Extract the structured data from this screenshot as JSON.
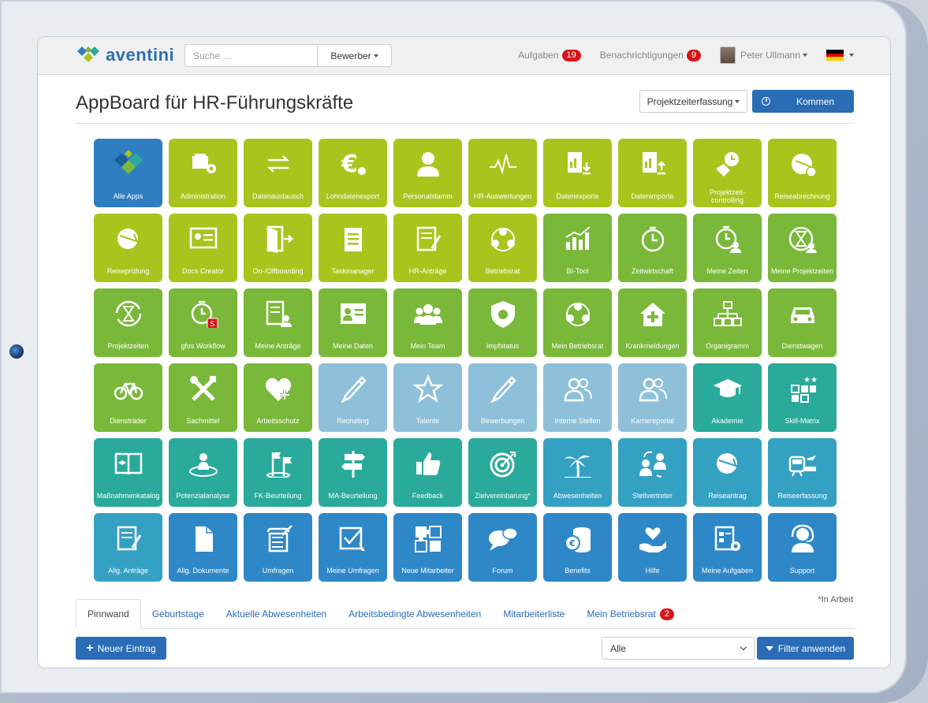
{
  "brand": {
    "name": "aventini"
  },
  "header": {
    "search_placeholder": "Suche ...",
    "search_scope": "Bewerber",
    "tasks_label": "Aufgaben",
    "tasks_count": "19",
    "notifications_label": "Benachrichtigungen",
    "notifications_count": "9",
    "user_name": "Peter Ullmann"
  },
  "page": {
    "title": "AppBoard für HR-Führungskräfte",
    "project_button": "Projektzeiterfassung",
    "kommen_button": "Kommen"
  },
  "tiles": [
    {
      "label": "Alle Apps",
      "color": "blue",
      "icon": "diamond-logo-icon"
    },
    {
      "label": "Administration",
      "color": "lime",
      "icon": "admin-icon"
    },
    {
      "label": "Datenaustausch",
      "color": "lime",
      "icon": "exchange-arrows-icon"
    },
    {
      "label": "Lohndatenexport",
      "color": "lime",
      "icon": "euro-icon"
    },
    {
      "label": "Personalstamm",
      "color": "lime",
      "icon": "person-icon"
    },
    {
      "label": "HR-Auswertungen",
      "color": "lime",
      "icon": "pulse-icon"
    },
    {
      "label": "Datenexporte",
      "color": "lime",
      "icon": "xls-export-icon"
    },
    {
      "label": "Datenimporte",
      "color": "lime",
      "icon": "xls-import-icon"
    },
    {
      "label": "Projektzeit-controlling",
      "color": "lime",
      "icon": "hand-clock-icon"
    },
    {
      "label": "Reiseabrechnung",
      "color": "lime",
      "icon": "globe-plane-euro-icon"
    },
    {
      "label": "Reiseprüfung",
      "color": "lime",
      "icon": "globe-plane-icon"
    },
    {
      "label": "Docs Creator",
      "color": "lime",
      "icon": "certificate-icon"
    },
    {
      "label": "On-/Offboarding",
      "color": "lime",
      "icon": "door-icon"
    },
    {
      "label": "Taskmanager",
      "color": "lime",
      "icon": "clipboard-icon"
    },
    {
      "label": "HR-Anträge",
      "color": "lime",
      "icon": "form-pen-icon"
    },
    {
      "label": "Betriebsrat",
      "color": "lime",
      "icon": "group-circle-icon"
    },
    {
      "label": "BI-Tool",
      "color": "green",
      "icon": "bar-chart-icon"
    },
    {
      "label": "Zeitwirtschaft",
      "color": "green",
      "icon": "stopwatch-icon"
    },
    {
      "label": "Meine Zeiten",
      "color": "green",
      "icon": "stopwatch-person-icon"
    },
    {
      "label": "Meine Projektzeiten",
      "color": "green",
      "icon": "hourglass-person-icon"
    },
    {
      "label": "Projektzeiten",
      "color": "green",
      "icon": "hourglass-icon"
    },
    {
      "label": "gfos Workflow",
      "color": "green",
      "icon": "stopwatch-badge-icon"
    },
    {
      "label": "Meine Anträge",
      "color": "green",
      "icon": "form-person-icon"
    },
    {
      "label": "Meine Daten",
      "color": "green",
      "icon": "id-card-icon"
    },
    {
      "label": "Mein Team",
      "color": "green",
      "icon": "team-icon"
    },
    {
      "label": "Impfstatus",
      "color": "green",
      "icon": "shield-virus-icon"
    },
    {
      "label": "Mein Betriebsrat",
      "color": "green",
      "icon": "group-circle-icon"
    },
    {
      "label": "Krankmeldungen",
      "color": "green",
      "icon": "house-cross-icon"
    },
    {
      "label": "Organigramm",
      "color": "green",
      "icon": "org-chart-icon"
    },
    {
      "label": "Dienstwagen",
      "color": "green",
      "icon": "car-icon"
    },
    {
      "label": "Diensträder",
      "color": "green",
      "icon": "bicycle-icon"
    },
    {
      "label": "Sachmittel",
      "color": "green",
      "icon": "tools-icon"
    },
    {
      "label": "Arbeitsschutz",
      "color": "green",
      "icon": "heart-plus-icon"
    },
    {
      "label": "Recruiting",
      "color": "lightblue",
      "icon": "fountain-pen-icon"
    },
    {
      "label": "Talente",
      "color": "lightblue",
      "icon": "star-icon"
    },
    {
      "label": "Bewerbungen",
      "color": "lightblue",
      "icon": "fountain-pen-icon"
    },
    {
      "label": "Interne Stellen",
      "color": "lightblue",
      "icon": "people-outline-icon"
    },
    {
      "label": "Karriereportal",
      "color": "lightblue",
      "icon": "people-outline-icon"
    },
    {
      "label": "Akademie",
      "color": "teal",
      "icon": "graduation-cap-icon"
    },
    {
      "label": "Skill-Matrix",
      "color": "teal",
      "icon": "skill-grid-icon"
    },
    {
      "label": "Maßnahmenkatalog",
      "color": "teal",
      "icon": "book-icon"
    },
    {
      "label": "Potenzialanalyse",
      "color": "teal",
      "icon": "person-target-icon"
    },
    {
      "label": "FK-Beurteilung",
      "color": "teal",
      "icon": "flags-icon"
    },
    {
      "label": "MA-Beurteilung",
      "color": "teal",
      "icon": "signpost-icon"
    },
    {
      "label": "Feedback",
      "color": "teal",
      "icon": "thumbs-up-icon"
    },
    {
      "label": "Zielvereinbarung*",
      "color": "teal",
      "icon": "target-icon"
    },
    {
      "label": "Abwesenheiten",
      "color": "cyan",
      "icon": "palm-icon"
    },
    {
      "label": "Stellvertreter",
      "color": "cyan",
      "icon": "swap-people-icon"
    },
    {
      "label": "Reiseantrag",
      "color": "cyan",
      "icon": "globe-plane-icon"
    },
    {
      "label": "Reiseerfassung",
      "color": "cyan",
      "icon": "train-plane-icon"
    },
    {
      "label": "Allg. Anträge",
      "color": "cyan",
      "icon": "form-pen-icon"
    },
    {
      "label": "Allg. Dokumente",
      "color": "mblue",
      "icon": "document-icon"
    },
    {
      "label": "Umfragen",
      "color": "mblue",
      "icon": "survey-icon"
    },
    {
      "label": "Meine Umfragen",
      "color": "mblue",
      "icon": "checkbox-cursor-icon"
    },
    {
      "label": "Neue Mitarbeiter",
      "color": "mblue",
      "icon": "puzzle-icon"
    },
    {
      "label": "Forum",
      "color": "mblue",
      "icon": "chat-bubbles-icon"
    },
    {
      "label": "Benefits",
      "color": "mblue",
      "icon": "coins-euro-icon"
    },
    {
      "label": "Hilfe",
      "color": "mblue",
      "icon": "hands-heart-icon"
    },
    {
      "label": "Meine Aufgaben",
      "color": "mblue",
      "icon": "clipboard-gear-icon"
    },
    {
      "label": "Support",
      "color": "mblue",
      "icon": "headset-icon"
    }
  ],
  "footnote": "*In Arbeit",
  "tabs": [
    {
      "label": "Pinnwand",
      "active": true
    },
    {
      "label": "Geburtstage"
    },
    {
      "label": "Aktuelle Abwesenheiten"
    },
    {
      "label": "Arbeitsbedingte Abwesenheiten"
    },
    {
      "label": "Mitarbeiterliste"
    },
    {
      "label": "Mein Betriebsrat",
      "badge": "2"
    }
  ],
  "actions": {
    "new_entry": "Neuer Eintrag",
    "filter_value": "Alle",
    "filter_button": "Filter anwenden"
  },
  "colors": {
    "blue": "#2f7ec1",
    "lime": "#a9c51d",
    "green": "#7ab83a",
    "lightblue": "#8fc0da",
    "teal": "#2aaa9a",
    "cyan": "#34a1c3",
    "mblue": "#2e88c8",
    "badge": "#d9141b",
    "primary": "#2a6cb5"
  }
}
